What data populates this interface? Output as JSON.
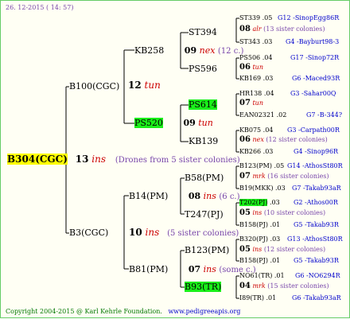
{
  "header": {
    "date": "26. 12-2015 ( 14: 57)"
  },
  "footer": {
    "copyright": "Copyright 2004-2015 @ Karl Kehrle Foundation.",
    "url": "www.pedigreeapis.org"
  },
  "root": {
    "name": "B304(CGC)",
    "num": "13",
    "ins": "ins",
    "desc": "(Drones from 5 sister colonies)"
  },
  "gen1": [
    {
      "name": "B100(CGC)",
      "num": "12",
      "ins": "tun"
    },
    {
      "name": "B3(CGC)",
      "num": "10",
      "ins": "ins",
      "desc": "(5 sister colonies)"
    }
  ],
  "gen2": [
    {
      "name": "KB258",
      "num": "09",
      "ins": "nex",
      "desc": "(12 c.)"
    },
    {
      "name": "PS520",
      "num": "09",
      "ins": "tun"
    },
    {
      "name": "B14(PM)",
      "num": "08",
      "ins": "ins",
      "desc": "(6 c.)"
    },
    {
      "name": "B81(PM)",
      "num": "07",
      "ins": "ins",
      "desc": "(some c.)"
    }
  ],
  "gen3": [
    {
      "name": "ST394",
      "num": "08",
      "ins": "alr",
      "desc": "(13 sister colonies)"
    },
    {
      "name": "PS596",
      "num": "06",
      "ins": "tun"
    },
    {
      "name": "PS614",
      "num": "07",
      "ins": "tun"
    },
    {
      "name": "KB139",
      "num": "06",
      "ins": "nex",
      "desc": "(12 sister colonies)"
    },
    {
      "name": "B58(PM)",
      "num": "07",
      "ins": "mrk",
      "desc": "(16 sister colonies)"
    },
    {
      "name": "T247(PJ)",
      "num": "05",
      "ins": "ins",
      "desc": "(10 sister colonies)"
    },
    {
      "name": "B123(PM)",
      "num": "05",
      "ins": "ins",
      "desc": "(12 sister colonies)"
    },
    {
      "name": "B93(TR)",
      "num": "04",
      "ins": "mrk",
      "desc": "(15 sister colonies)"
    }
  ],
  "gen4": [
    {
      "name": "ST339",
      "num": ".05",
      "ref": "G12 -SinopEgg86R"
    },
    {
      "name": "ST343",
      "num": ".03",
      "ref": "G4 -Bayburt98-3"
    },
    {
      "name": "PS506",
      "num": ".04",
      "ref": "G17 -Sinop72R"
    },
    {
      "name": "KB169",
      "num": ".03",
      "ref": "G6 -Maced93R"
    },
    {
      "name": "HR138",
      "num": ".04",
      "ref": "G3 -Sahar00Q"
    },
    {
      "name": "EAN02321",
      "num": ".02",
      "ref": "G7 -B-344?"
    },
    {
      "name": "KB075",
      "num": ".04",
      "ref": "G3 -Carpath00R"
    },
    {
      "name": "KB266",
      "num": ".03",
      "ref": "G4 -Sinop96R"
    },
    {
      "name": "B123(PM)",
      "num": ".05",
      "ref": "G14 -AthosSt80R"
    },
    {
      "name": "B19(MKK)",
      "num": ".03",
      "ref": "G7 -Takab93aR"
    },
    {
      "name": "T202(PJ)",
      "num": ".03",
      "ref": "G2 -Athos00R"
    },
    {
      "name": "B158(PJ)",
      "num": ".01",
      "ref": "G5 -Takab93R"
    },
    {
      "name": "B320(PJ)",
      "num": ".03",
      "ref": "G13 -AthosSt80R"
    },
    {
      "name": "B158(PJ)",
      "num": ".01",
      "ref": "G5 -Takab93R"
    },
    {
      "name": "NO61(TR)",
      "num": ".01",
      "ref": "G6 -NO6294R"
    },
    {
      "name": "I89(TR)",
      "num": ".01",
      "ref": "G6 -Takab93aR"
    }
  ]
}
